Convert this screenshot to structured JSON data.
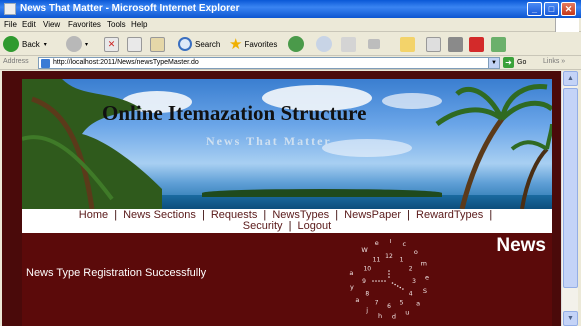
{
  "window": {
    "title": "News That Matter - Microsoft Internet Explorer",
    "minimize": "_",
    "maximize": "□",
    "close": "✕"
  },
  "menu": [
    "File",
    "Edit",
    "View",
    "Favorites",
    "Tools",
    "Help"
  ],
  "toolbar": {
    "back_label": "Back",
    "search_label": "Search",
    "favorites_label": "Favorites"
  },
  "address": {
    "label": "Address",
    "url": "http://localhost:2011/News/newsTypeMaster.do",
    "go_label": "Go",
    "links_label": "Links"
  },
  "banner": {
    "title": "Online Itemazation Structure",
    "subtitle": "News That Matter"
  },
  "nav": {
    "items": [
      "Home",
      "News Sections",
      "Requests",
      "NewsTypes",
      "NewsPaper",
      "RewardTypes",
      "Security",
      "Logout"
    ],
    "separator": "|"
  },
  "main": {
    "message": "News Type Registration Successfully",
    "heading": "News",
    "clock_text": "Welcome Saudhjaya",
    "clock_numbers": [
      "12",
      "1",
      "2",
      "3",
      "4",
      "5",
      "6",
      "7",
      "8",
      "9",
      "10",
      "11"
    ]
  },
  "colors": {
    "page_bg": "#4a0a0a",
    "main_bg": "#5b0a0a",
    "titlebar": "#0a58d6"
  }
}
